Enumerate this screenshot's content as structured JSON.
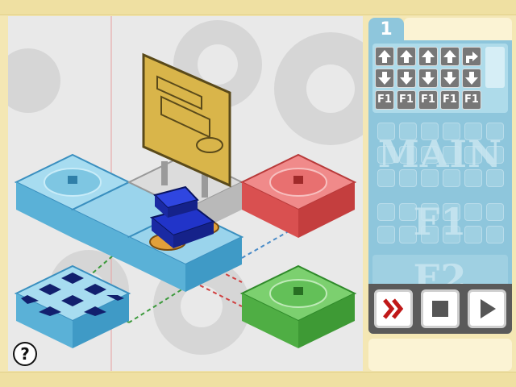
{
  "level": {
    "number": "1"
  },
  "help": {
    "label": "?"
  },
  "palette": {
    "rows": [
      [
        "up-arrow",
        "up-arrow",
        "up-arrow",
        "up-arrow",
        "turn-right-arrow"
      ],
      [
        "down-arrow",
        "down-arrow",
        "down-arrow",
        "down-arrow",
        "down-arrow"
      ],
      [
        "F1",
        "F1",
        "F1",
        "F1",
        "F1"
      ]
    ],
    "f1_label": "F1"
  },
  "program": {
    "main_label": "MAIN",
    "f1_label": "F1",
    "f2_label": "F2"
  },
  "controls": {
    "fast_forward_icon": "fast-forward-icon",
    "stop_icon": "stop-icon",
    "play_icon": "play-icon"
  },
  "colors": {
    "panel_blue": "#8ec6dc",
    "tile_blue": "#8fd0ea",
    "tile_red": "#e85a5a",
    "tile_green": "#55b94a",
    "robot_blue": "#2134c9",
    "sign_gold": "#d9b54a"
  }
}
